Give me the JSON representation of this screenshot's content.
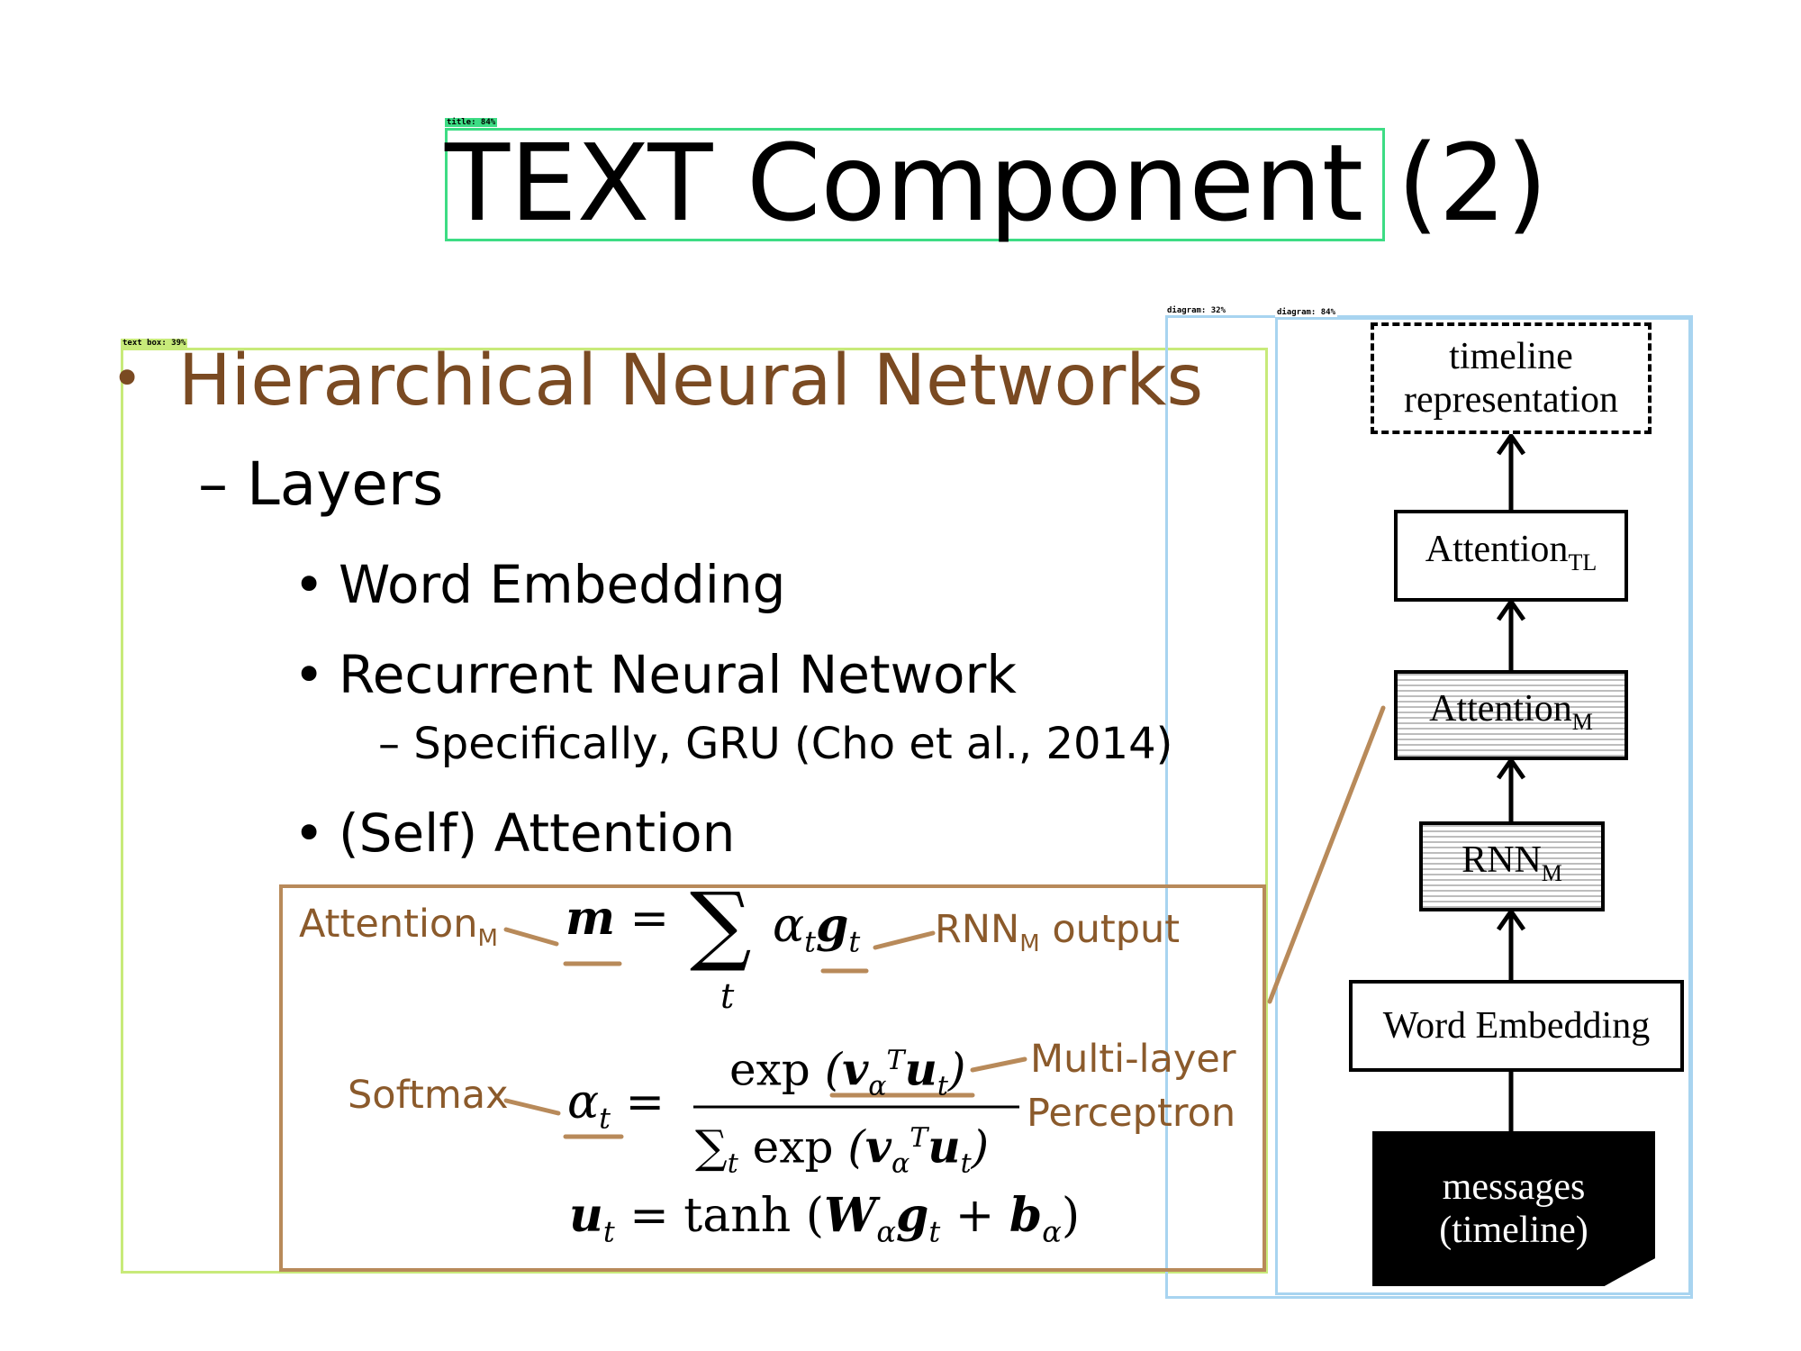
{
  "detections": {
    "title_label": "title: 84%",
    "textbox_label": "text box: 39%",
    "diagram1_label": "diagram: 32%",
    "diagram2_label": "diagram: 84%"
  },
  "slide": {
    "title": "TEXT Component (2)",
    "bullet_main": "Hierarchical Neural Networks",
    "sub_layers": "– Layers",
    "item_word_embedding": "Word Embedding",
    "item_rnn": "Recurrent Neural Network",
    "item_gru": "– Specifically, GRU (Cho et al., 2014)",
    "item_attention": "(Self) Attention",
    "bullet_glyph": "•"
  },
  "formula_annotations": {
    "attention_main": "Attention",
    "attention_sub": "M",
    "rnn_main": "RNN",
    "rnn_sub": "M",
    "rnn_suffix": " output",
    "softmax": "Softmax",
    "mlp_line1": "Multi-layer",
    "mlp_line2": "Perceptron"
  },
  "diagram": {
    "timeline_rep_line1": "timeline",
    "timeline_rep_line2": "representation",
    "attention_tl_main": "Attention",
    "attention_tl_sub": "TL",
    "attention_m_main": "Attention",
    "attention_m_sub": "M",
    "rnn_m_main": "RNN",
    "rnn_m_sub": "M",
    "word_embedding": "Word Embedding",
    "messages_line1": "messages",
    "messages_line2": "(timeline)"
  },
  "colors": {
    "accent_brown": "#7a4a22",
    "annotation_brown": "#8b5a2b",
    "formula_border": "#b88a5a",
    "title_box": "#3ddc84",
    "textbox_box": "#c8ea7a",
    "diagram_box": "#a8d4f0"
  }
}
